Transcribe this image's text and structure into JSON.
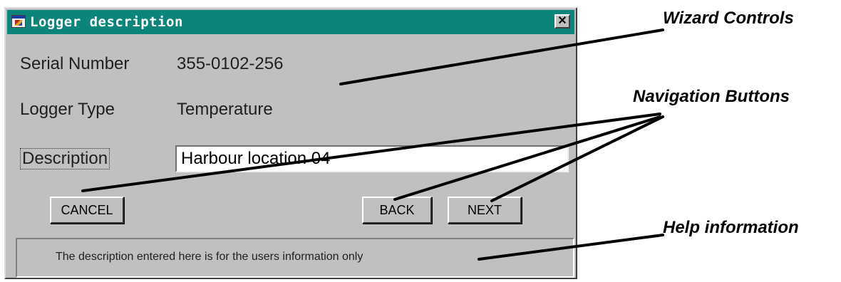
{
  "window": {
    "title": "Logger description",
    "icon": "app-icon",
    "close_icon": "close-icon"
  },
  "fields": {
    "serial_number_label": "Serial Number",
    "serial_number_value": "355-0102-256",
    "logger_type_label": "Logger Type",
    "logger_type_value": "Temperature",
    "description_label": "Description",
    "description_value": "Harbour location 04"
  },
  "buttons": {
    "cancel": "CANCEL",
    "back": "BACK",
    "next": "NEXT"
  },
  "help": {
    "text": "The description entered here is for the users information only"
  },
  "annotations": {
    "wizard_controls": "Wizard Controls",
    "navigation_buttons": "Navigation Buttons",
    "help_information": "Help information"
  },
  "colors": {
    "titlebar": "#0b8479",
    "window_bg": "#c0c0c0"
  }
}
